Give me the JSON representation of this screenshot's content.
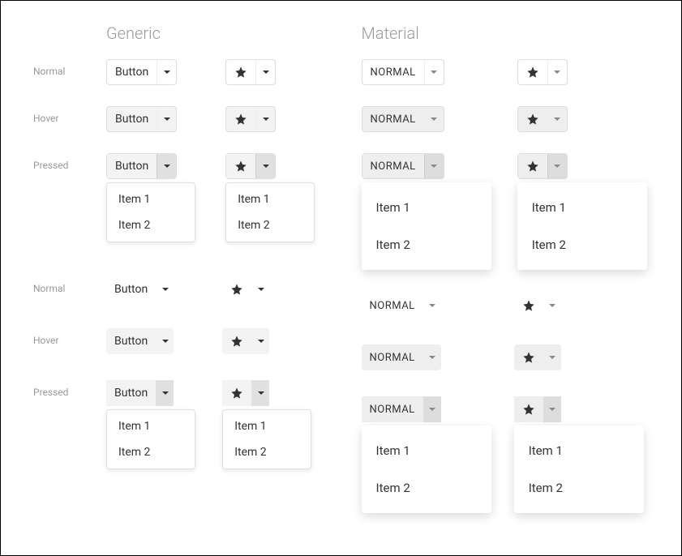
{
  "titles": {
    "generic": "Generic",
    "material": "Material"
  },
  "states": {
    "normal": "Normal",
    "hover": "Hover",
    "pressed": "Pressed"
  },
  "buttons": {
    "generic_label": "Button",
    "material_label": "Normal"
  },
  "menu": {
    "items": [
      "Item 1",
      "Item 2"
    ]
  }
}
